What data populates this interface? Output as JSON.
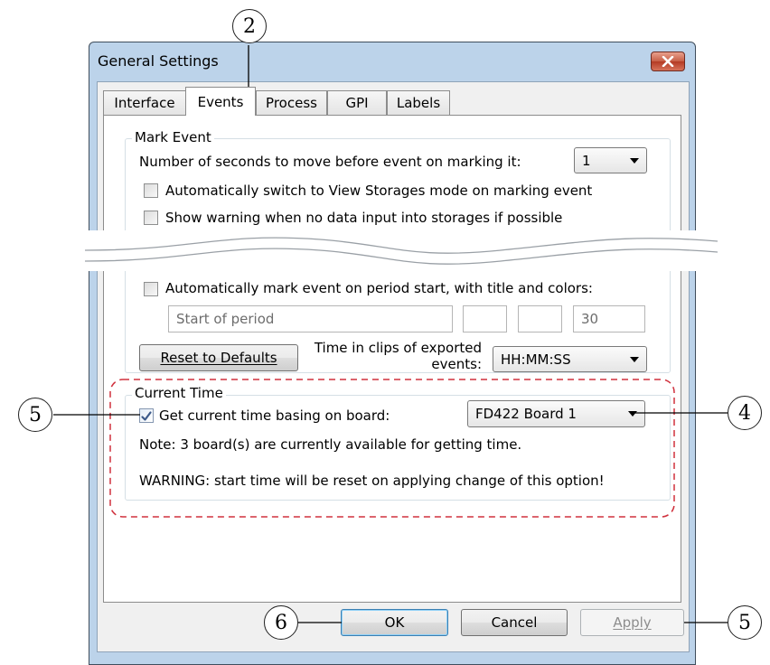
{
  "window": {
    "title": "General Settings"
  },
  "tabs": [
    {
      "label": "Interface"
    },
    {
      "label": "Events"
    },
    {
      "label": "Process"
    },
    {
      "label": "GPI"
    },
    {
      "label": "Labels"
    }
  ],
  "mark_event": {
    "legend": "Mark Event",
    "seconds_label": "Number of seconds to move before event on marking it:",
    "seconds_value": "1",
    "auto_switch_label": "Automatically switch to View Storages mode on marking event",
    "show_warning_label": "Show warning when no data input into storages if possible",
    "auto_mark_label": "Automatically mark event on period start, with title and colors:",
    "period_title_placeholder": "Start of period",
    "period_number": "30",
    "reset_button": "Reset to Defaults",
    "time_format_label_line1": "Time in clips of exported",
    "time_format_label_line2": "events:",
    "time_format_value": "HH:MM:SS"
  },
  "current_time": {
    "legend": "Current Time",
    "get_time_label": "Get current time basing on board:",
    "board_value": "FD422 Board 1",
    "note": "Note: 3 board(s) are currently available for getting time.",
    "warning": "WARNING: start time will be reset on applying change of this option!"
  },
  "buttons": {
    "ok": "OK",
    "cancel": "Cancel",
    "apply": "Apply"
  },
  "callouts": {
    "tab": "2",
    "checkbox": "5",
    "combo": "4",
    "ok": "6",
    "apply": "5"
  },
  "colors": {
    "dashed_highlight": "#d0313d",
    "close_button": "#c75e45"
  }
}
